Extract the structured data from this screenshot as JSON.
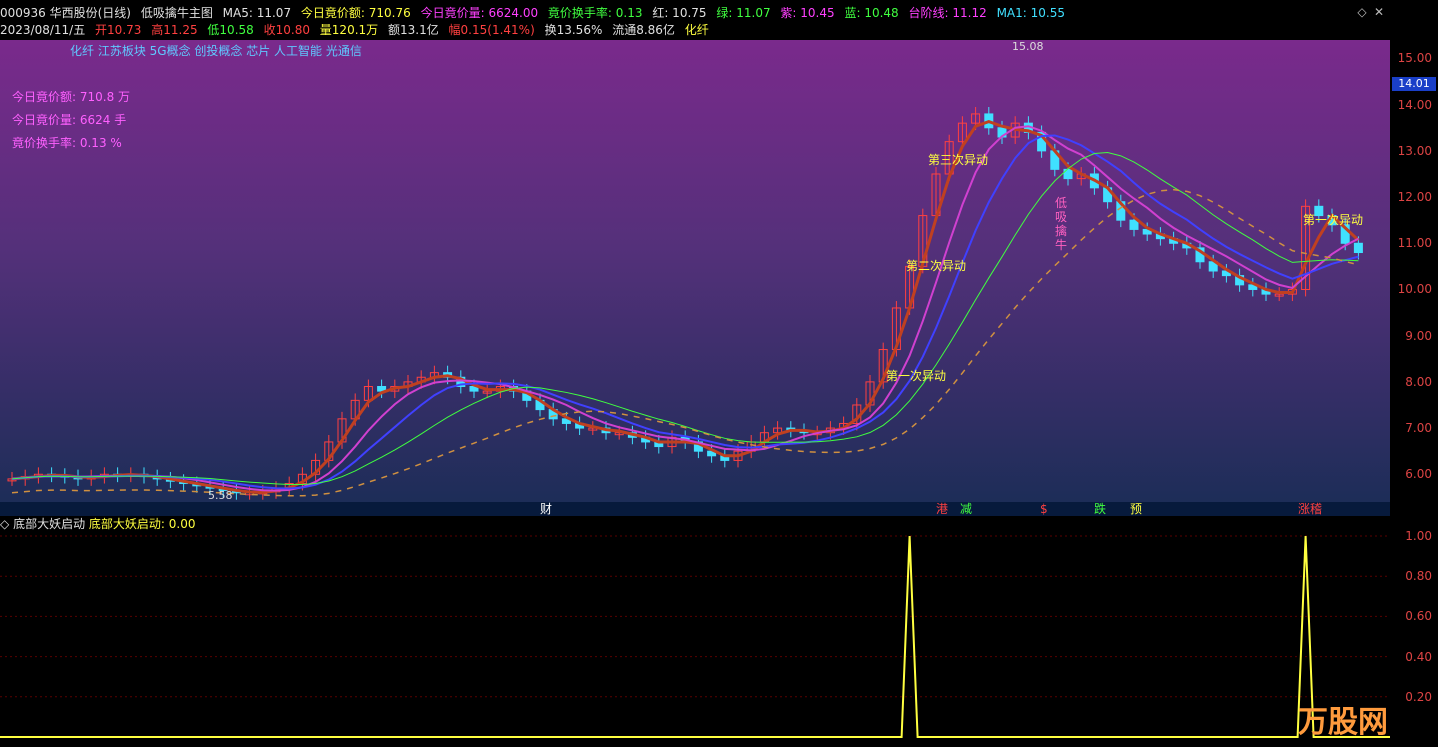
{
  "header": {
    "code_name": "000936 华西股份(日线)",
    "indicator": "低吸擒牛主图",
    "ma5": "MA5: 11.07",
    "jj_amount": "今日竟价额: 710.76",
    "jj_volume": "今日竟价量: 6624.00",
    "jj_turnover": "竟价换手率: 0.13",
    "red": "红: 10.75",
    "green": "绿: 11.07",
    "purple": "紫: 10.45",
    "blue": "蓝: 10.48",
    "step_line": "台阶线: 11.12",
    "ma1": "MA1: 10.55"
  },
  "quote": {
    "date": "2023/08/11/五",
    "open": "开10.73",
    "high": "高11.25",
    "low": "低10.58",
    "close": "收10.80",
    "volume": "量120.1万",
    "amount": "额13.1亿",
    "change": "幅0.15(1.41%)",
    "turnover": "换13.56%",
    "float": "流通8.86亿",
    "sector": "化纤"
  },
  "concepts": "化纤 江苏板块 5G概念 创投概念 芯片 人工智能 光通信",
  "stats": {
    "amount": "今日竟价额: 710.8 万",
    "volume": "今日竟价量: 6624 手",
    "turnover": "竟价换手率: 0.13 %"
  },
  "notes": {
    "first": "第一次异动",
    "second": "第二次异动",
    "third": "第三次异动",
    "fourth": "第一次异动",
    "buy_a": "低",
    "buy_b": "吸",
    "buy_c": "擒",
    "buy_d": "牛"
  },
  "price_labels": {
    "high": "15.08",
    "low": "5.58"
  },
  "current_price": "14.01",
  "main_axis": [
    "15.00",
    "14.00",
    "13.00",
    "12.00",
    "11.00",
    "10.00",
    "9.00",
    "8.00",
    "7.00",
    "6.00"
  ],
  "sub_axis": [
    "1.00",
    "0.80",
    "0.60",
    "0.40",
    "0.20"
  ],
  "markers": [
    {
      "label": "财",
      "color": "#ffffff"
    },
    {
      "label": "港",
      "color": "#ff4040"
    },
    {
      "label": "减",
      "color": "#40ff40"
    },
    {
      "label": "$",
      "color": "#ff4040"
    },
    {
      "label": "跌",
      "color": "#40ff40"
    },
    {
      "label": "预",
      "color": "#ffff40"
    },
    {
      "label": "涨稽",
      "color": "#ff4040"
    }
  ],
  "sub": {
    "title": "底部大妖启动",
    "value": "底部大妖启动: 0.00"
  },
  "logo": {
    "name": "万股网",
    "url": "www.2010Z.com"
  },
  "colors": {
    "rise": "#ff4040",
    "fall": "#40e0ff",
    "accent": "#ffff40",
    "axis": "#dd4444"
  },
  "chart_data": {
    "type": "line",
    "title": "低吸擒牛主图",
    "ylim": [
      5.4,
      15.4
    ],
    "close": [
      5.9,
      5.95,
      6.0,
      5.98,
      5.95,
      5.9,
      5.95,
      6.0,
      5.98,
      6.0,
      5.95,
      5.9,
      5.85,
      5.8,
      5.75,
      5.7,
      5.65,
      5.6,
      5.6,
      5.62,
      5.7,
      5.8,
      6.0,
      6.3,
      6.7,
      7.2,
      7.6,
      7.9,
      7.8,
      7.9,
      8.0,
      8.1,
      8.2,
      8.1,
      7.9,
      7.8,
      7.8,
      7.9,
      7.8,
      7.6,
      7.4,
      7.2,
      7.1,
      7.0,
      7.0,
      6.9,
      6.9,
      6.8,
      6.7,
      6.6,
      6.8,
      6.7,
      6.5,
      6.4,
      6.3,
      6.5,
      6.7,
      6.9,
      7.0,
      6.95,
      6.9,
      6.9,
      7.0,
      7.1,
      7.5,
      8.0,
      8.7,
      9.6,
      10.5,
      11.6,
      12.5,
      13.2,
      13.6,
      13.8,
      13.5,
      13.3,
      13.6,
      13.4,
      13.0,
      12.6,
      12.4,
      12.5,
      12.2,
      11.9,
      11.5,
      11.3,
      11.2,
      11.1,
      11.0,
      10.9,
      10.6,
      10.4,
      10.3,
      10.1,
      10.0,
      9.9,
      9.9,
      10.0,
      11.8,
      11.6,
      11.4,
      11.0,
      10.8
    ],
    "signal": {
      "x": [
        68,
        98
      ],
      "y": [
        1.0,
        1.0
      ]
    }
  }
}
